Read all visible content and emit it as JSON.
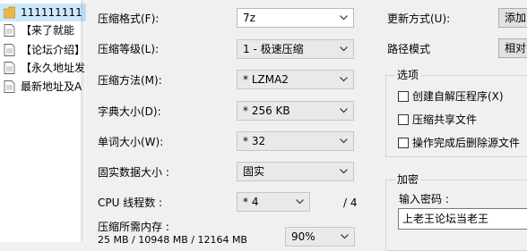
{
  "files": [
    {
      "icon": "folder-icon",
      "name": "111111111"
    },
    {
      "icon": "document-icon",
      "name": "【来了就能"
    },
    {
      "icon": "document-icon",
      "name": "【论坛介绍】"
    },
    {
      "icon": "document-icon",
      "name": "【永久地址发"
    },
    {
      "icon": "document-icon",
      "name": "最新地址及A"
    }
  ],
  "options": {
    "format_label": "压缩格式(F):",
    "format_value": "7z",
    "level_label": "压缩等级(L):",
    "level_value": "1 - 极速压缩",
    "method_label": "压缩方法(M):",
    "method_value": "* LZMA2",
    "dict_label": "字典大小(D):",
    "dict_value": "* 256 KB",
    "word_label": "单词大小(W):",
    "word_value": "* 32",
    "solid_label": "固实数据大小 :",
    "solid_value": "固实",
    "threads_label": "CPU 线程数 :",
    "threads_value": "* 4",
    "threads_max": "/ 4",
    "memory_label": "压缩所需内存 :",
    "memory_info": "25 MB / 10948 MB / 12164 MB",
    "memory_percent": "90%"
  },
  "right": {
    "update_label": "更新方式(U):",
    "update_value": "添加",
    "path_label": "路径模式",
    "path_value": "相对",
    "options_group": "选项",
    "sfx_label": "创建自解压程序(X)",
    "shared_label": "压缩共享文件",
    "delete_label": "操作完成后删除源文件",
    "encrypt_group": "加密",
    "password_label": "输入密码 :",
    "password_value": "上老王论坛当老王"
  }
}
